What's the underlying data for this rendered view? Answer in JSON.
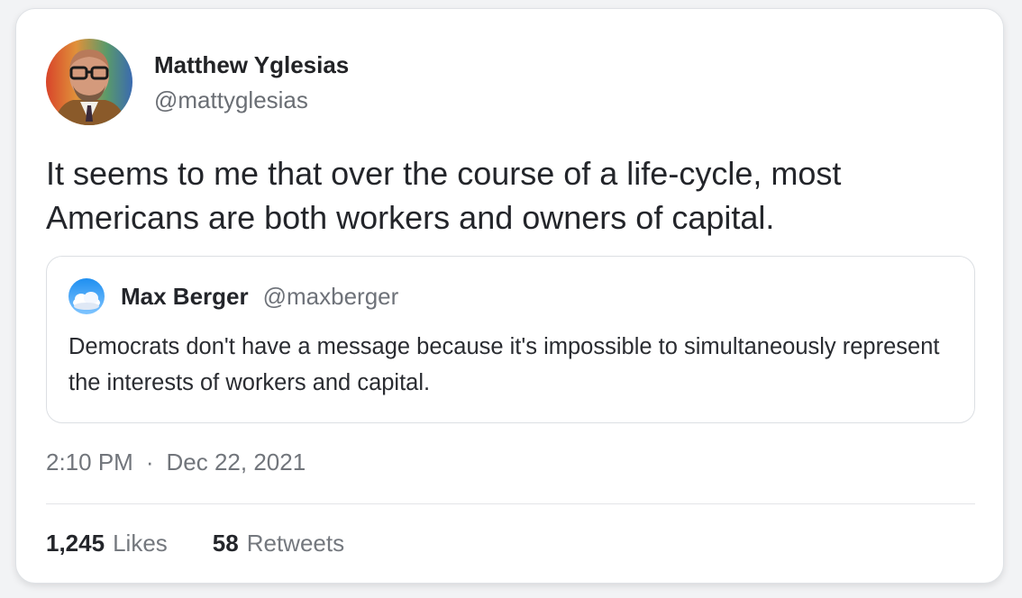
{
  "tweet": {
    "author_name": "Matthew Yglesias",
    "author_handle": "@mattyglesias",
    "avatar_icon": "author-photo-avatar",
    "text": "It seems to me that over the course of a life-cycle, most Americans are both workers and owners of capital.",
    "time": "2:10 PM",
    "separator": "·",
    "date": "Dec 22, 2021"
  },
  "quote": {
    "author_name": "Max Berger",
    "author_handle": "@maxberger",
    "avatar_icon": "sky-clouds-avatar",
    "text": "Democrats don't have a message because it's impossible to simultaneously represent the interests of workers and capital."
  },
  "stats": {
    "likes_count": "1,245",
    "likes_label": "Likes",
    "retweets_count": "58",
    "retweets_label": "Retweets"
  },
  "colors": {
    "card_background": "#ffffff",
    "page_background": "#f2f3f5",
    "primary_text": "#23252a",
    "secondary_text": "#6e7279",
    "border": "#dcdfe3"
  }
}
